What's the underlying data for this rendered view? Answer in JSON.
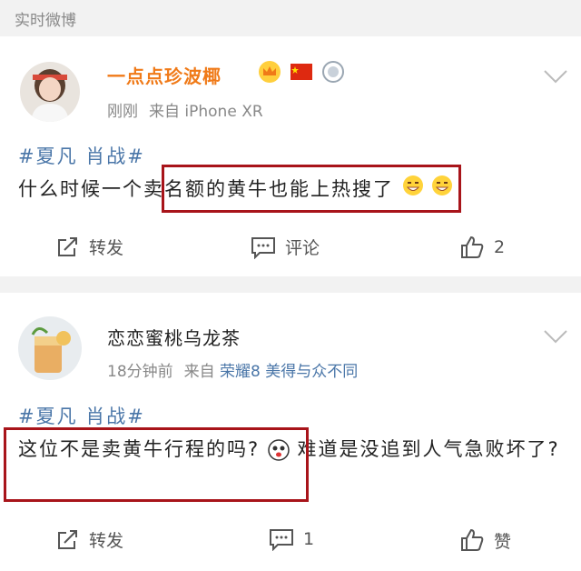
{
  "section": {
    "title": "实时微博"
  },
  "posts": [
    {
      "username": "一点点珍波椰",
      "badges": [
        "vip-crown-icon",
        "china-flag-icon",
        "medal-icon"
      ],
      "time": "刚刚",
      "source_prefix": "来自",
      "source": "iPhone XR",
      "source_extra": "",
      "topic": "#夏凡 肖战#",
      "text": "什么时候一个卖名额的黄牛也能上热搜了",
      "emojis": [
        "grin-emoji",
        "grin-emoji"
      ],
      "actions": {
        "repost": "转发",
        "comment": "评论",
        "like": "2"
      }
    },
    {
      "username": "恋恋蜜桃乌龙茶",
      "badges": [],
      "time": "18分钟前",
      "source_prefix": "来自",
      "source": "荣耀8",
      "source_extra": "美得与众不同",
      "topic": "#夏凡 肖战#",
      "text_a": "这位不是卖黄牛行程的吗?",
      "text_b": "难道是没追到人气急败坏了?",
      "emojis": [
        "shocked-emoji"
      ],
      "actions": {
        "repost": "转发",
        "comment": "1",
        "like": "赞"
      }
    }
  ],
  "colors": {
    "username_orange": "#f07a18",
    "link_blue": "#4a76a8",
    "highlight_red": "#a8141a"
  }
}
